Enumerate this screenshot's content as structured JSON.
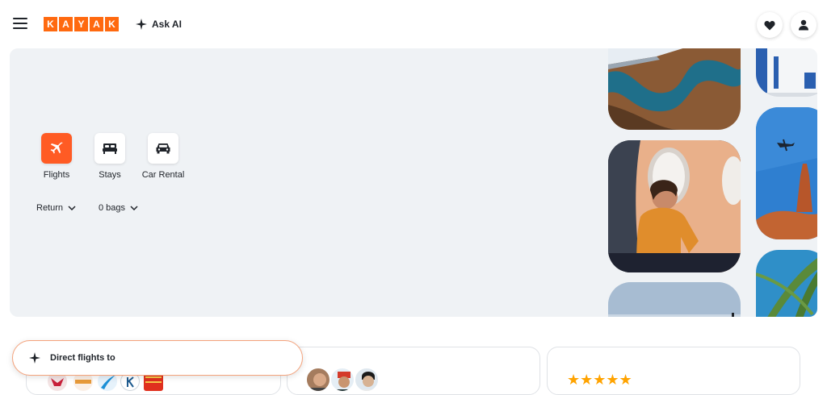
{
  "header": {
    "logo_letters": [
      "K",
      "A",
      "Y",
      "A",
      "K"
    ],
    "ask_ai_label": "Ask AI",
    "icons": {
      "menu": "hamburger-menu-icon",
      "sparkle": "sparkle-icon",
      "favorites": "heart-icon",
      "account": "person-icon"
    }
  },
  "search": {
    "verticals": [
      {
        "label": "Flights",
        "icon": "plane-icon",
        "active": true
      },
      {
        "label": "Stays",
        "icon": "bed-icon",
        "active": false
      },
      {
        "label": "Car Rental",
        "icon": "car-icon",
        "active": false
      }
    ],
    "trip_type": "Return",
    "bags": "0 bags"
  },
  "ai_prompt": {
    "text": "Direct flights to"
  },
  "cards": {
    "rating_stars": "★★★★★"
  },
  "colors": {
    "brand": "#ff690f",
    "active_vertical": "#ff5b24",
    "hero_bg": "#eff2f5",
    "star": "#ffa300"
  }
}
